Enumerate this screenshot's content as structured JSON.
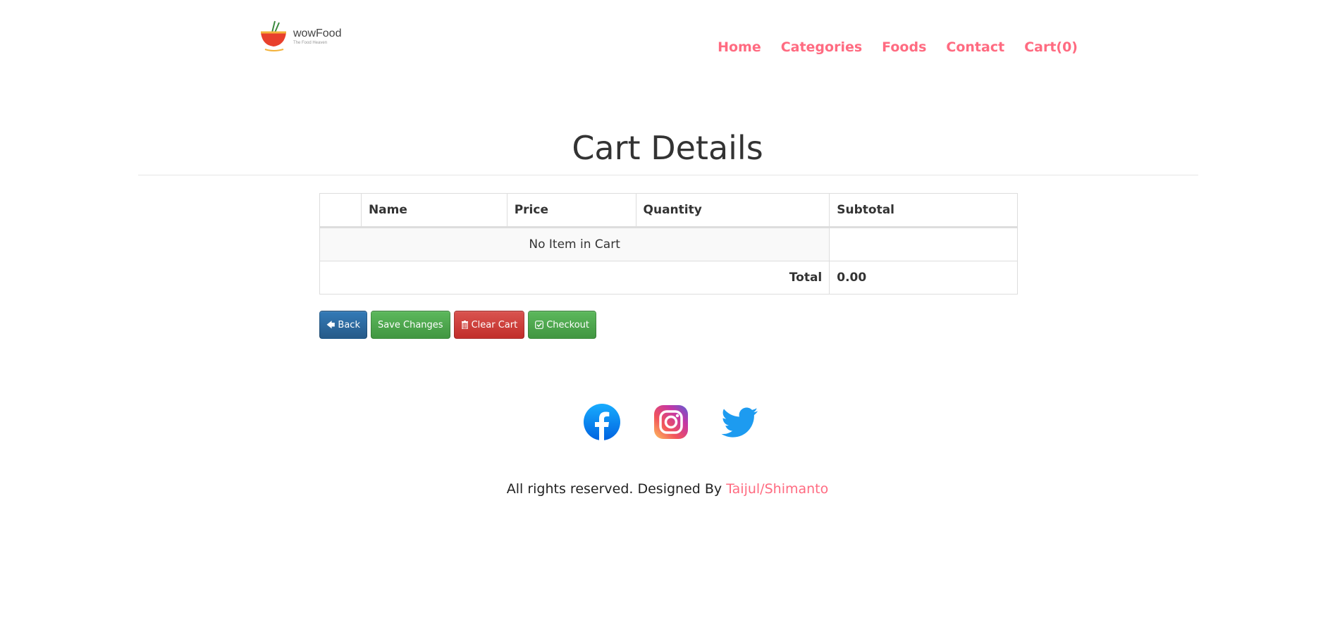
{
  "header": {
    "logo": {
      "name": "wowFood",
      "tagline": "The Food Heaven"
    },
    "nav": [
      "Home",
      "Categories",
      "Foods",
      "Contact",
      "Cart(0)"
    ],
    "accent_color": "#ff6b81"
  },
  "page_title": "Cart Details",
  "cart_table": {
    "columns": [
      "",
      "Name",
      "Price",
      "Quantity",
      "Subtotal"
    ],
    "empty_message": "No Item in Cart",
    "total_label": "Total",
    "total_value": "0.00"
  },
  "actions": {
    "back": {
      "label": "Back",
      "icon": "arrow-left-icon"
    },
    "save": {
      "label": "Save Changes"
    },
    "clear": {
      "label": "Clear Cart",
      "icon": "trash-icon"
    },
    "checkout": {
      "label": "Checkout",
      "icon": "check-square-icon"
    }
  },
  "social": [
    "facebook-icon",
    "instagram-icon",
    "twitter-icon"
  ],
  "footer": {
    "text": "All rights reserved. Designed By ",
    "link": "Taijul/Shimanto"
  }
}
